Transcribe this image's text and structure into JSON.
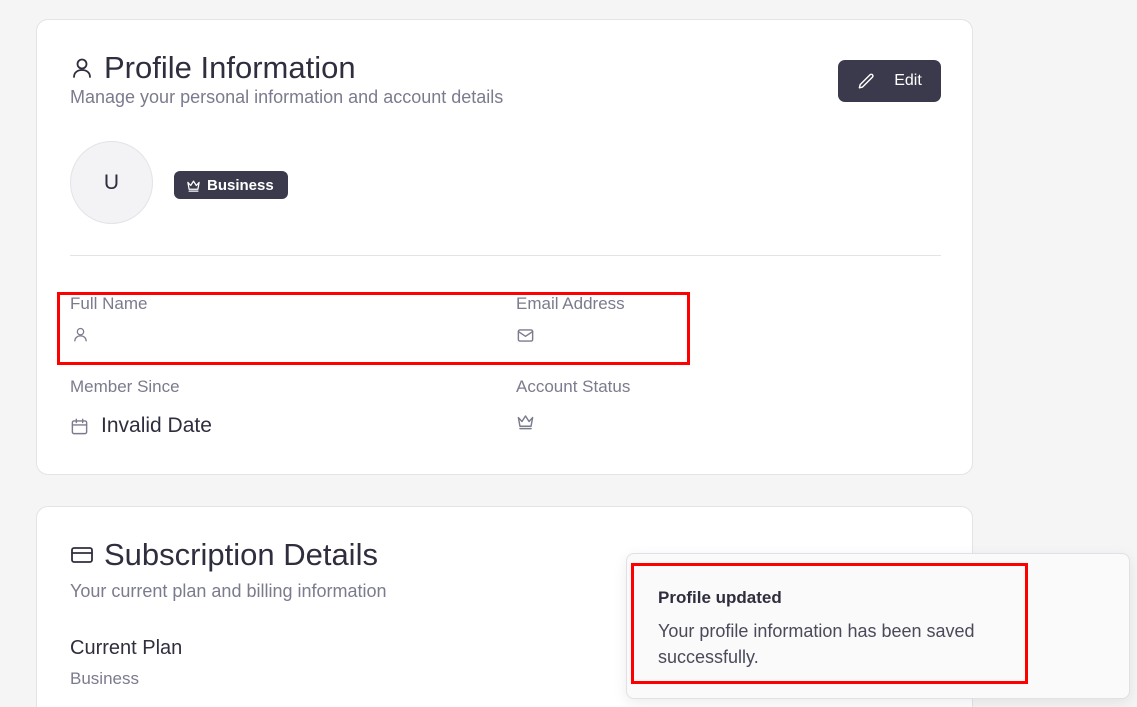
{
  "profile": {
    "title": "Profile Information",
    "subtitle": "Manage your personal information and account details",
    "edit_label": "Edit",
    "avatar_initial": "U",
    "plan_badge": "Business",
    "fields": {
      "full_name_label": "Full Name",
      "full_name_value": "",
      "email_label": "Email Address",
      "email_value": "",
      "member_since_label": "Member Since",
      "member_since_value": "Invalid Date",
      "account_status_label": "Account Status",
      "account_status_value": ""
    }
  },
  "subscription": {
    "title": "Subscription Details",
    "subtitle": "Your current plan and billing information",
    "current_plan_label": "Current Plan",
    "current_plan_value": "Business"
  },
  "toast": {
    "title": "Profile updated",
    "message": "Your profile information has been saved successfully."
  },
  "colors": {
    "background": "#f5f5f5",
    "card": "#ffffff",
    "primary_dark": "#3a3a4c",
    "muted_text": "#7b7b8e",
    "highlight": "#ff0000"
  },
  "icons": [
    "user-icon",
    "pencil-icon",
    "crown-icon",
    "mail-icon",
    "calendar-icon",
    "credit-card-icon"
  ]
}
